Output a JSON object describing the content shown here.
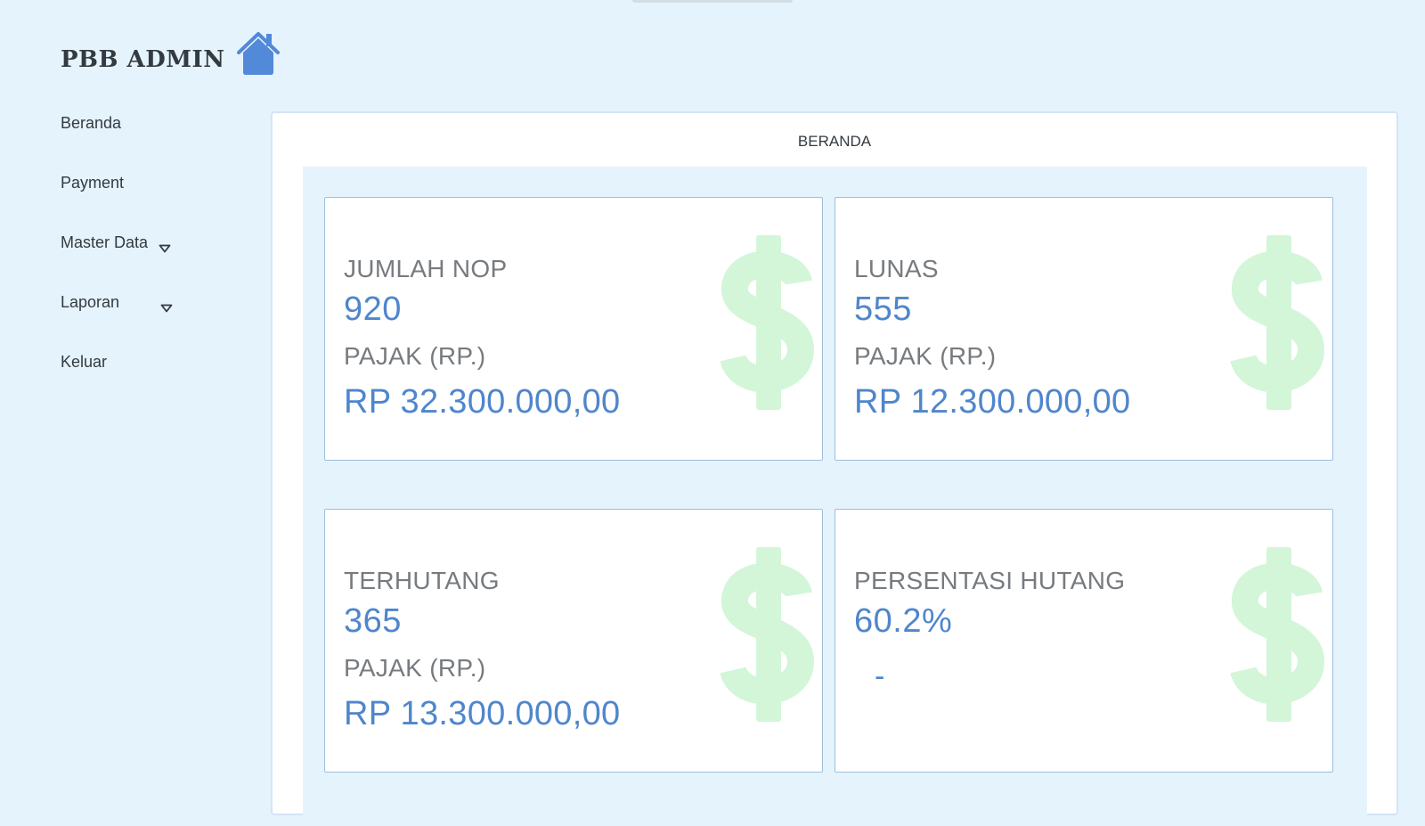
{
  "brand": {
    "title": "PBB ADMIN",
    "icon": "home-icon",
    "icon_color": "#5289d8"
  },
  "sidebar": {
    "items": [
      {
        "label": "Beranda",
        "has_dropdown": false
      },
      {
        "label": "Payment",
        "has_dropdown": false
      },
      {
        "label": "Master Data",
        "has_dropdown": true
      },
      {
        "label": "Laporan",
        "has_dropdown": true
      },
      {
        "label": "Keluar",
        "has_dropdown": false
      }
    ]
  },
  "main": {
    "title": "BERANDA",
    "cards": [
      {
        "label": "JUMLAH NOP",
        "value": "920",
        "sub_label": "PAJAK (RP.)",
        "amount": "RP 32.300.000,00",
        "icon": "dollar-icon"
      },
      {
        "label": "LUNAS",
        "value": "555",
        "sub_label": "PAJAK (RP.)",
        "amount": "RP 12.300.000,00",
        "icon": "dollar-icon"
      },
      {
        "label": "TERHUTANG",
        "value": "365",
        "sub_label": "PAJAK (RP.)",
        "amount": "RP 13.300.000,00",
        "icon": "dollar-icon"
      },
      {
        "label": "PERSENTASI HUTANG",
        "value": "60.2%",
        "note": "-",
        "icon": "dollar-icon"
      }
    ]
  },
  "colors": {
    "background": "#e5f3fc",
    "accent": "#4f86cc",
    "label_gray": "#777b7f",
    "icon_green": "#d3f6d8",
    "card_border": "#9dbedc"
  }
}
